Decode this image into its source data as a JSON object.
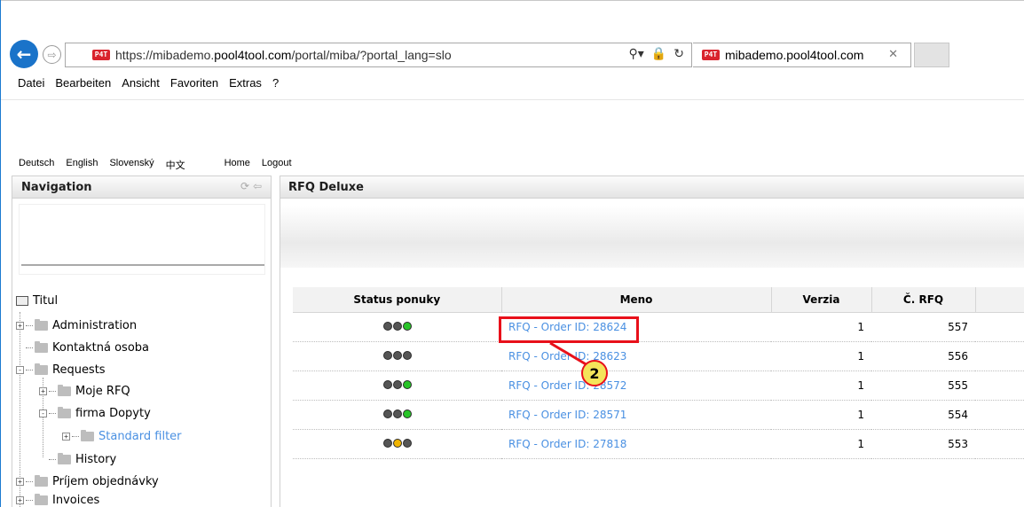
{
  "browser": {
    "url_pre": "https://mibademo.",
    "url_domain": "pool4tool.com",
    "url_post": "/portal/miba/?portal_lang=slo",
    "tab_title": "mibademo.pool4tool.com",
    "site_icon_text": "P4T",
    "menu": [
      "Datei",
      "Bearbeiten",
      "Ansicht",
      "Favoriten",
      "Extras",
      "?"
    ]
  },
  "portal": {
    "languages": [
      "Deutsch",
      "English",
      "Slovenský",
      "中文"
    ],
    "links": [
      "Home",
      "Logout"
    ],
    "nav_title": "Navigation",
    "main_title": "RFQ Deluxe"
  },
  "tree": {
    "root": "Titul",
    "items": [
      {
        "label": "Administration",
        "toggle": "+"
      },
      {
        "label": "Kontaktná osoba",
        "toggle": ""
      },
      {
        "label": "Requests",
        "toggle": "-"
      },
      {
        "label": "Moje RFQ",
        "toggle": "+"
      },
      {
        "label": "firma Dopyty",
        "toggle": "-"
      },
      {
        "label": "Standard filter",
        "toggle": "+"
      },
      {
        "label": "History",
        "toggle": ""
      },
      {
        "label": "Príjem objednávky",
        "toggle": "+"
      },
      {
        "label": "Invoices",
        "toggle": "+"
      }
    ]
  },
  "table": {
    "headers": [
      "Status ponuky",
      "Meno",
      "Verzia",
      "Č. RFQ"
    ],
    "rows": [
      {
        "status": [
          "#555555",
          "#555555",
          "#28c428"
        ],
        "meno": "RFQ - Order ID: 28624",
        "verzia": "1",
        "rfq": "557"
      },
      {
        "status": [
          "#555555",
          "#555555",
          "#555555"
        ],
        "meno": "RFQ - Order ID: 28623",
        "verzia": "1",
        "rfq": "556"
      },
      {
        "status": [
          "#555555",
          "#555555",
          "#28c428"
        ],
        "meno": "RFQ - Order ID: 28572",
        "verzia": "1",
        "rfq": "555"
      },
      {
        "status": [
          "#555555",
          "#555555",
          "#28c428"
        ],
        "meno": "RFQ - Order ID: 28571",
        "verzia": "1",
        "rfq": "554"
      },
      {
        "status": [
          "#555555",
          "#f0b400",
          "#555555"
        ],
        "meno": "RFQ - Order ID: 27818",
        "verzia": "1",
        "rfq": "553"
      }
    ]
  },
  "callout": {
    "number": "2"
  },
  "colors": {
    "link": "#4a90e2",
    "callout_red": "#e8101a",
    "callout_fill": "#f4e45a",
    "browser_blue": "#1a73c9"
  }
}
